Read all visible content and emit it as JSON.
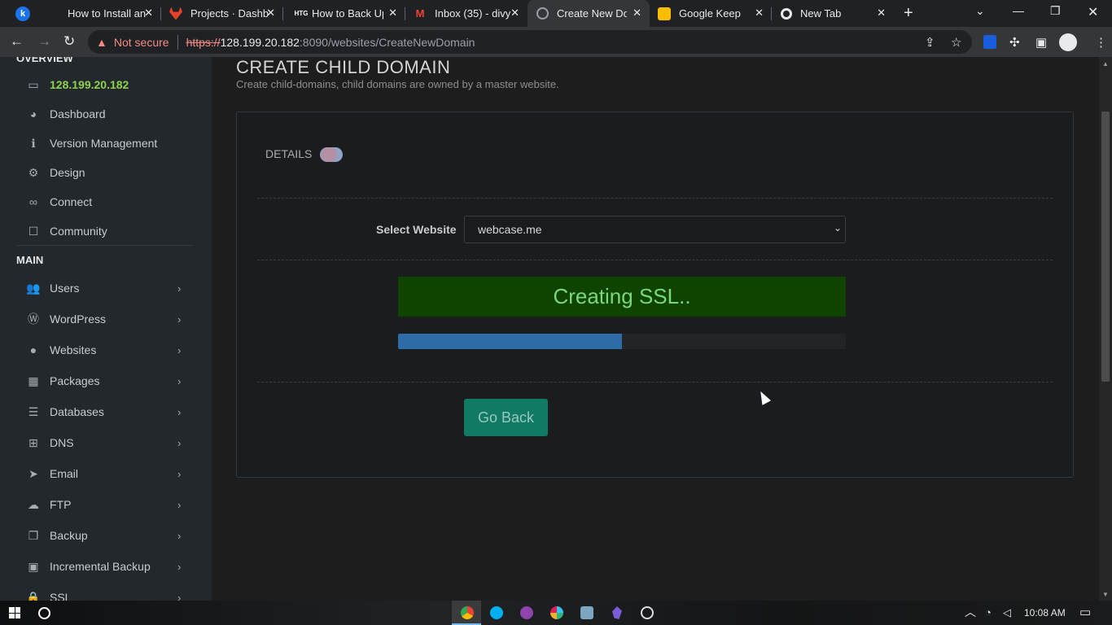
{
  "browser": {
    "tabs": [
      {
        "title": "How to Install an",
        "favicon": "k",
        "favicon_color": "#1a73e8",
        "active": false
      },
      {
        "title": "Projects · Dashb",
        "favicon": "gitlab-icon",
        "favicon_color": "#e24329",
        "active": false
      },
      {
        "title": "How to Back Up",
        "favicon": "HTG",
        "favicon_color": "#202124",
        "active": false
      },
      {
        "title": "Inbox (35) - divy",
        "favicon": "M",
        "favicon_color": "#ea4335",
        "active": false
      },
      {
        "title": "Create New Dom",
        "favicon": "globe-icon",
        "favicon_color": "#9aa0a6",
        "active": true
      },
      {
        "title": "Google Keep",
        "favicon": "keep-icon",
        "favicon_color": "#fbbc04",
        "active": false
      },
      {
        "title": "New Tab",
        "favicon": "chrome-icon",
        "favicon_color": "#e8eaed",
        "active": false
      }
    ],
    "security_label": "Not secure",
    "url_scheme": "https://",
    "url_host": "128.199.20.182",
    "url_path": ":8090/websites/CreateNewDomain"
  },
  "sidebar": {
    "overview_heading": "OVERVIEW",
    "server_ip": "128.199.20.182",
    "overview_items": [
      {
        "label": "Dashboard",
        "icon": "palette-icon"
      },
      {
        "label": "Version Management",
        "icon": "info-icon"
      },
      {
        "label": "Design",
        "icon": "gear-icon"
      },
      {
        "label": "Connect",
        "icon": "link-icon"
      },
      {
        "label": "Community",
        "icon": "chat-icon"
      }
    ],
    "main_heading": "MAIN",
    "main_items": [
      {
        "label": "Users",
        "icon": "users-icon"
      },
      {
        "label": "WordPress",
        "icon": "wordpress-icon"
      },
      {
        "label": "Websites",
        "icon": "globe-icon"
      },
      {
        "label": "Packages",
        "icon": "cubes-icon"
      },
      {
        "label": "Databases",
        "icon": "database-icon"
      },
      {
        "label": "DNS",
        "icon": "sitemap-icon"
      },
      {
        "label": "Email",
        "icon": "paper-plane-icon"
      },
      {
        "label": "FTP",
        "icon": "cloud-upload-icon"
      },
      {
        "label": "Backup",
        "icon": "clone-icon"
      },
      {
        "label": "Incremental Backup",
        "icon": "save-icon"
      },
      {
        "label": "SSL",
        "icon": "lock-icon"
      }
    ]
  },
  "main": {
    "title": "CREATE CHILD DOMAIN",
    "subtitle": "Create child-domains, child domains are owned by a master website.",
    "details_label": "DETAILS",
    "select_label": "Select Website",
    "selected_website": "webcase.me",
    "status_text": "Creating SSL..",
    "progress_fraction": 0.5,
    "go_back_label": "Go Back"
  },
  "taskbar": {
    "time": "10:08 AM"
  }
}
